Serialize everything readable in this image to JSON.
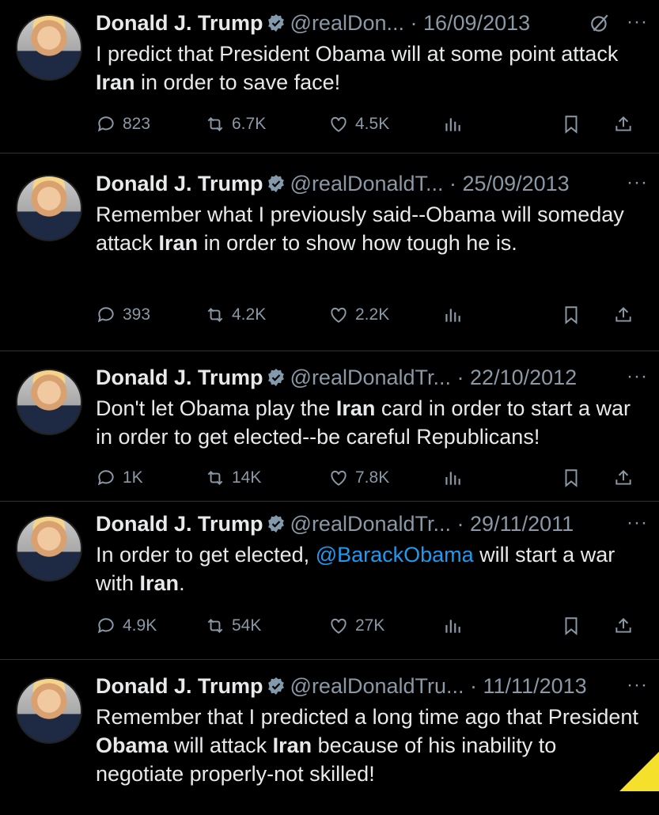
{
  "tweets": [
    {
      "name": "Donald J. Trump",
      "handle": "@realDon...",
      "date": "16/09/2013",
      "text": [
        {
          "t": "I predict that President Obama will at some point attack "
        },
        {
          "t": "Iran",
          "b": true
        },
        {
          "t": " in order to save face!"
        }
      ],
      "replies": "823",
      "retweets": "6.7K",
      "likes": "4.5K",
      "has_grok": true
    },
    {
      "name": "Donald J. Trump",
      "handle": "@realDonaldT...",
      "date": "25/09/2013",
      "text": [
        {
          "t": "Remember what I previously said--Obama will someday attack "
        },
        {
          "t": "Iran",
          "b": true
        },
        {
          "t": " in order to show how tough he is."
        }
      ],
      "replies": "393",
      "retweets": "4.2K",
      "likes": "2.2K",
      "has_grok": false
    },
    {
      "name": "Donald J. Trump",
      "handle": "@realDonaldTr...",
      "date": "22/10/2012",
      "text": [
        {
          "t": "Don't let Obama play the "
        },
        {
          "t": "Iran",
          "b": true
        },
        {
          "t": " card in order to start a war in order to get elected--be careful Republicans!"
        }
      ],
      "replies": "1K",
      "retweets": "14K",
      "likes": "7.8K",
      "has_grok": false
    },
    {
      "name": "Donald J. Trump",
      "handle": "@realDonaldTr...",
      "date": "29/11/2011",
      "text": [
        {
          "t": "In order to get elected, "
        },
        {
          "t": "@BarackObama",
          "m": true
        },
        {
          "t": " will start a war with "
        },
        {
          "t": "Iran",
          "b": true
        },
        {
          "t": "."
        }
      ],
      "replies": "4.9K",
      "retweets": "54K",
      "likes": "27K",
      "has_grok": false
    },
    {
      "name": "Donald J. Trump",
      "handle": "@realDonaldTru...",
      "date": "11/11/2013",
      "text": [
        {
          "t": "Remember that I predicted a long time ago that President "
        },
        {
          "t": "Obama",
          "b": true
        },
        {
          "t": " will attack "
        },
        {
          "t": "Iran",
          "b": true
        },
        {
          "t": " because of his inability to negotiate properly-not skilled!"
        }
      ],
      "replies": "",
      "retweets": "",
      "likes": "",
      "has_grok": false
    }
  ],
  "icons": {
    "reply": "reply-icon",
    "retweet": "retweet-icon",
    "like": "heart-icon",
    "views": "views-icon",
    "bookmark": "bookmark-icon",
    "share": "share-icon",
    "verified": "verified-badge-icon",
    "more": "more-icon",
    "grok": "grok-icon"
  },
  "colors": {
    "background": "#000000",
    "text": "#e7e9ea",
    "muted": "#8b98a5",
    "link": "#1d9bf0",
    "verified": "#829aab",
    "corner": "#f5e12b"
  }
}
